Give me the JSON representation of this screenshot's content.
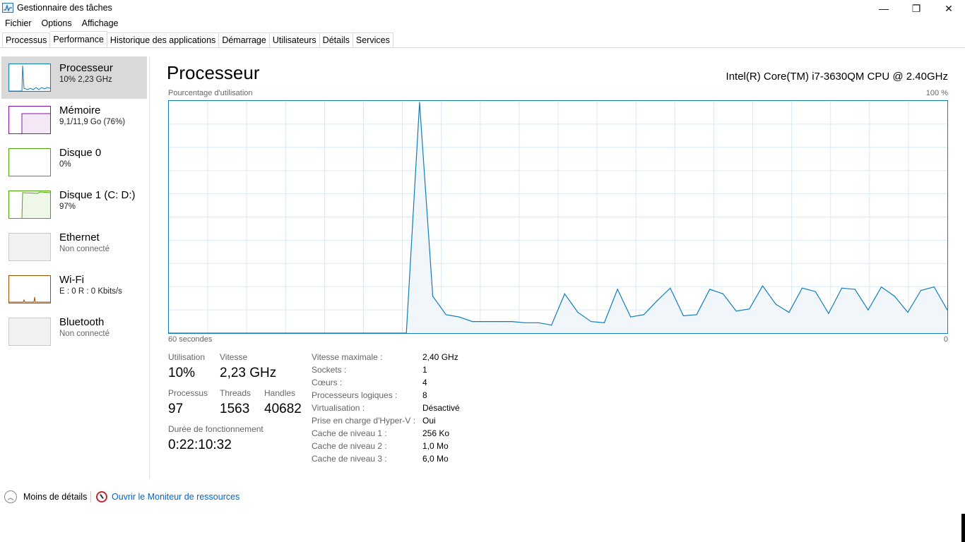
{
  "window": {
    "title": "Gestionnaire des tâches",
    "controls": {
      "minimize": "—",
      "maximize": "❐",
      "close": "✕"
    }
  },
  "menu": [
    "Fichier",
    "Options",
    "Affichage"
  ],
  "tabs": [
    "Processus",
    "Performance",
    "Historique des applications",
    "Démarrage",
    "Utilisateurs",
    "Détails",
    "Services"
  ],
  "active_tab": "Performance",
  "sidebar": [
    {
      "title": "Processeur",
      "sub": "10%  2,23 GHz",
      "color": "#117dbb",
      "active": true
    },
    {
      "title": "Mémoire",
      "sub": "9,1/11,9 Go (76%)",
      "color": "#8b12ae",
      "active": false
    },
    {
      "title": "Disque 0",
      "sub": "0%",
      "color": "#4da60c",
      "active": false
    },
    {
      "title": "Disque 1 (C: D:)",
      "sub": "97%",
      "color": "#4da60c",
      "active": false
    },
    {
      "title": "Ethernet",
      "sub": "Non connecté",
      "color": "#a74f01",
      "active": false
    },
    {
      "title": "Wi-Fi",
      "sub": "E : 0  R : 0 Kbits/s",
      "color": "#a74f01",
      "active": false
    },
    {
      "title": "Bluetooth",
      "sub": "Non connecté",
      "color": "#a74f01",
      "active": false
    }
  ],
  "main": {
    "title": "Processeur",
    "cpu_name": "Intel(R) Core(TM) i7-3630QM CPU @ 2.40GHz",
    "graph_label": "Pourcentage d'utilisation",
    "graph_max": "100 %",
    "graph_span": "60 secondes",
    "graph_min": "0",
    "accent_color": "#117dbb"
  },
  "chart_data": {
    "type": "area",
    "title": "",
    "xlabel": "60 secondes",
    "ylabel": "Pourcentage d'utilisation",
    "ylim": [
      0,
      100
    ],
    "xlim": [
      0,
      60
    ],
    "grid": true,
    "series": [
      {
        "values": [
          0,
          0,
          0,
          0,
          0,
          0,
          0,
          0,
          0,
          0,
          0,
          0,
          0,
          0,
          0,
          0,
          0,
          0,
          0,
          100,
          16,
          8,
          7,
          5,
          5,
          5,
          5,
          4.5,
          4.5,
          3.5,
          17,
          9,
          5,
          4.5,
          19,
          7,
          8,
          14,
          19.5,
          7.5,
          8,
          19,
          17,
          9.5,
          10.5,
          20.5,
          12.5,
          9,
          19.5,
          18,
          8.5,
          19.5,
          19,
          10,
          20,
          16,
          9,
          18.5,
          20,
          10
        ]
      }
    ]
  },
  "stats": {
    "utilisation_label": "Utilisation",
    "utilisation_value": "10%",
    "vitesse_label": "Vitesse",
    "vitesse_value": "2,23 GHz",
    "processus_label": "Processus",
    "processus_value": "97",
    "threads_label": "Threads",
    "threads_value": "1563",
    "handles_label": "Handles",
    "handles_value": "40682",
    "uptime_label": "Durée de fonctionnement",
    "uptime_value": "0:22:10:32"
  },
  "info": [
    {
      "label": "Vitesse maximale :",
      "value": "2,40 GHz"
    },
    {
      "label": "Sockets :",
      "value": "1"
    },
    {
      "label": "Cœurs :",
      "value": "4"
    },
    {
      "label": "Processeurs logiques :",
      "value": "8"
    },
    {
      "label": "Virtualisation :",
      "value": "Désactivé"
    },
    {
      "label": "Prise en charge d'Hyper-V :",
      "value": "Oui"
    },
    {
      "label": "Cache de niveau 1 :",
      "value": "256 Ko"
    },
    {
      "label": "Cache de niveau 2 :",
      "value": "1,0 Mo"
    },
    {
      "label": "Cache de niveau 3 :",
      "value": "6,0 Mo"
    }
  ],
  "footer": {
    "less_details": "Moins de détails",
    "resource_monitor": "Ouvrir le Moniteur de ressources"
  }
}
